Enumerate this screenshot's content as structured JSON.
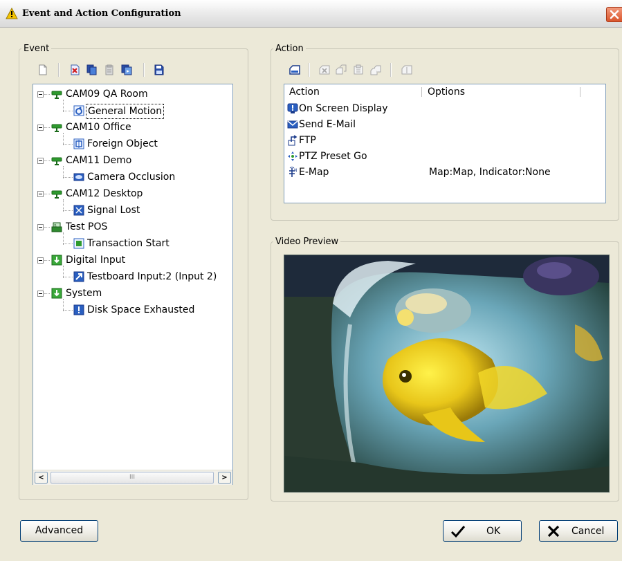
{
  "window": {
    "title": "Event and Action Configuration"
  },
  "event_panel": {
    "legend": "Event",
    "toolbar": [
      {
        "icon": "new-event-icon",
        "color": "#ffffff"
      },
      {
        "icon": "delete-event-icon",
        "color": "#d02020"
      },
      {
        "icon": "copy-event-icon",
        "color": "#2a4fa8"
      },
      {
        "icon": "paste-event-icon",
        "color": "#9a9a9a"
      },
      {
        "icon": "duplicate-event-icon",
        "color": "#2a4fa8"
      },
      {
        "icon": "save-event-icon",
        "color": "#2a4fa8"
      }
    ],
    "tree": [
      {
        "device": "CAM09 QA Room",
        "device_icon": "camera-icon",
        "event": "General Motion",
        "event_icon": "motion-icon",
        "selected": true
      },
      {
        "device": "CAM10 Office",
        "device_icon": "camera-icon",
        "event": "Foreign Object",
        "event_icon": "foreign-object-icon"
      },
      {
        "device": "CAM11 Demo",
        "device_icon": "camera-icon",
        "event": "Camera Occlusion",
        "event_icon": "occlusion-icon"
      },
      {
        "device": "CAM12 Desktop",
        "device_icon": "camera-icon",
        "event": "Signal Lost",
        "event_icon": "signal-lost-icon"
      },
      {
        "device": "Test POS",
        "device_icon": "pos-icon",
        "event": "Transaction Start",
        "event_icon": "transaction-icon"
      },
      {
        "device": "Digital Input",
        "device_icon": "digital-input-icon",
        "event": "Testboard Input:2 (Input 2)",
        "event_icon": "input-icon"
      },
      {
        "device": "System",
        "device_icon": "system-icon",
        "event": "Disk Space Exhausted",
        "event_icon": "disk-space-icon"
      }
    ],
    "scrollbar_thumb_text": "III"
  },
  "action_panel": {
    "legend": "Action",
    "columns": [
      "Action",
      "Options"
    ],
    "rows": [
      {
        "icon": "osd-icon",
        "name": "On Screen Display",
        "options": ""
      },
      {
        "icon": "email-icon",
        "name": "Send E-Mail",
        "options": ""
      },
      {
        "icon": "ftp-icon",
        "name": "FTP",
        "options": ""
      },
      {
        "icon": "ptz-icon",
        "name": "PTZ Preset Go",
        "options": ""
      },
      {
        "icon": "emap-icon",
        "name": "E-Map",
        "options": "Map:Map, Indicator:None"
      }
    ]
  },
  "video_panel": {
    "legend": "Video Preview"
  },
  "buttons": {
    "advanced": "Advanced",
    "ok": "OK",
    "cancel": "Cancel"
  },
  "colors": {
    "window_bg": "#ece9d8",
    "list_border": "#7f9db9",
    "close_button": "#d9542b",
    "camera_green": "#2e9a2e",
    "icon_blue": "#2a5fc0"
  }
}
